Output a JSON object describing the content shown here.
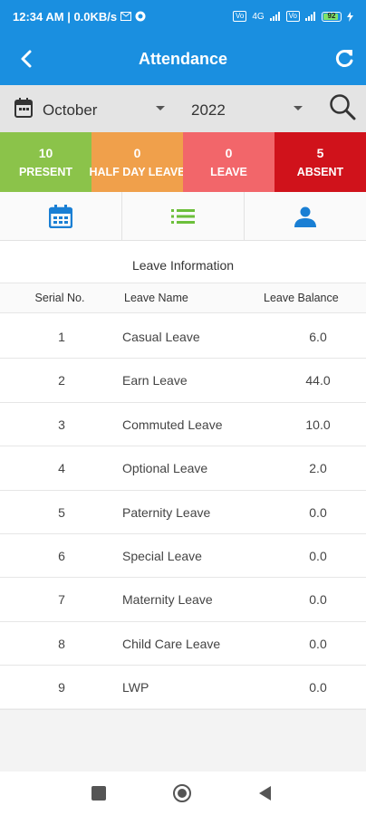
{
  "status_bar": {
    "time_info": "12:34 AM | 0.0KB/s",
    "battery": "92",
    "chip_1": "Vo",
    "chip_2": "Vo",
    "network": "4G"
  },
  "app_bar": {
    "title": "Attendance",
    "back_icon": "chevron-left-icon",
    "refresh_icon": "refresh-icon"
  },
  "filter": {
    "month": "October",
    "year": "2022"
  },
  "stats": [
    {
      "count": "10",
      "label": "PRESENT",
      "color": "#8bc34a"
    },
    {
      "count": "0",
      "label": "HALF DAY LEAVE",
      "color": "#f0a04b"
    },
    {
      "count": "0",
      "label": "LEAVE",
      "color": "#f2666a"
    },
    {
      "count": "5",
      "label": "ABSENT",
      "color": "#d0121b"
    }
  ],
  "tabs": {
    "calendar_icon": "calendar-icon",
    "list_icon": "list-icon",
    "person_icon": "person-icon",
    "active_color": "#1a7fd4",
    "list_color": "#6cbf3b"
  },
  "leave_info": {
    "title": "Leave Information",
    "headers": {
      "serial": "Serial No.",
      "name": "Leave Name",
      "balance": "Leave Balance"
    },
    "rows": [
      {
        "serial": "1",
        "name": "Casual Leave",
        "balance": "6.0"
      },
      {
        "serial": "2",
        "name": "Earn Leave",
        "balance": "44.0"
      },
      {
        "serial": "3",
        "name": "Commuted Leave",
        "balance": "10.0"
      },
      {
        "serial": "4",
        "name": "Optional Leave",
        "balance": "2.0"
      },
      {
        "serial": "5",
        "name": "Paternity Leave",
        "balance": "0.0"
      },
      {
        "serial": "6",
        "name": "Special Leave",
        "balance": "0.0"
      },
      {
        "serial": "7",
        "name": "Maternity Leave",
        "balance": "0.0"
      },
      {
        "serial": "8",
        "name": "Child Care Leave",
        "balance": "0.0"
      },
      {
        "serial": "9",
        "name": "LWP",
        "balance": "0.0"
      }
    ]
  }
}
